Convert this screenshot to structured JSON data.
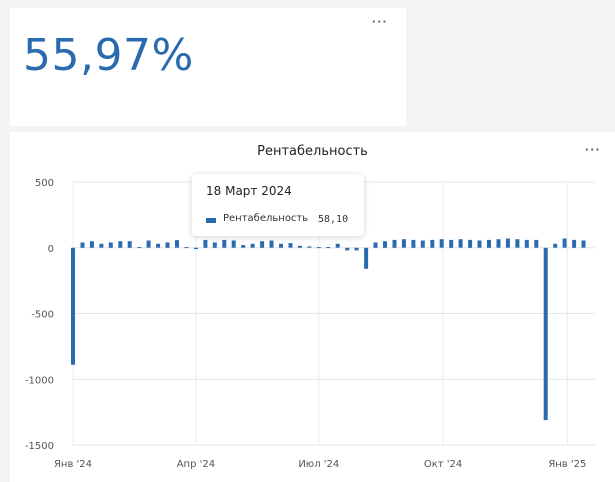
{
  "kpi": {
    "value": "55,97%"
  },
  "menu_label": "···",
  "chart_data": {
    "type": "bar",
    "title": "Рентабельность",
    "xlabel": "",
    "ylabel": "",
    "ylim": [
      -1500,
      500
    ],
    "y_ticks": [
      500,
      0,
      -500,
      -1000,
      -1500
    ],
    "x_tick_labels": [
      "Янв '24",
      "Апр '24",
      "Июл '24",
      "Окт '24",
      "Янв '25"
    ],
    "grid": true,
    "series": [
      {
        "name": "Рентабельность",
        "color": "#2a6bb0",
        "categories": [
          "2024-01-01",
          "2024-01-08",
          "2024-01-15",
          "2024-01-22",
          "2024-01-29",
          "2024-02-05",
          "2024-02-12",
          "2024-02-19",
          "2024-02-26",
          "2024-03-04",
          "2024-03-11",
          "2024-03-18",
          "2024-03-25",
          "2024-04-01",
          "2024-04-08",
          "2024-04-15",
          "2024-04-22",
          "2024-04-29",
          "2024-05-06",
          "2024-05-13",
          "2024-05-20",
          "2024-05-27",
          "2024-06-03",
          "2024-06-10",
          "2024-06-17",
          "2024-06-24",
          "2024-07-01",
          "2024-07-08",
          "2024-07-15",
          "2024-07-22",
          "2024-07-29",
          "2024-08-05",
          "2024-08-12",
          "2024-08-19",
          "2024-08-26",
          "2024-09-02",
          "2024-09-09",
          "2024-09-16",
          "2024-09-23",
          "2024-09-30",
          "2024-10-07",
          "2024-10-14",
          "2024-10-21",
          "2024-10-28",
          "2024-11-04",
          "2024-11-11",
          "2024-11-18",
          "2024-11-25",
          "2024-12-02",
          "2024-12-09",
          "2024-12-16",
          "2024-12-23",
          "2024-12-30",
          "2025-01-06",
          "2025-01-13",
          "2025-01-20"
        ],
        "values": [
          -890,
          40,
          50,
          30,
          40,
          50,
          50,
          5,
          55,
          30,
          40,
          58.1,
          5,
          -10,
          60,
          40,
          60,
          55,
          20,
          30,
          50,
          55,
          30,
          35,
          15,
          10,
          5,
          5,
          30,
          -20,
          -20,
          -160,
          40,
          50,
          60,
          65,
          60,
          55,
          60,
          65,
          60,
          65,
          60,
          55,
          60,
          65,
          70,
          65,
          60,
          60,
          -1310,
          30,
          70,
          60,
          55
        ]
      }
    ],
    "tooltip": {
      "date": "18 Март 2024",
      "series": "Рентабельность",
      "value": "58,10"
    }
  }
}
